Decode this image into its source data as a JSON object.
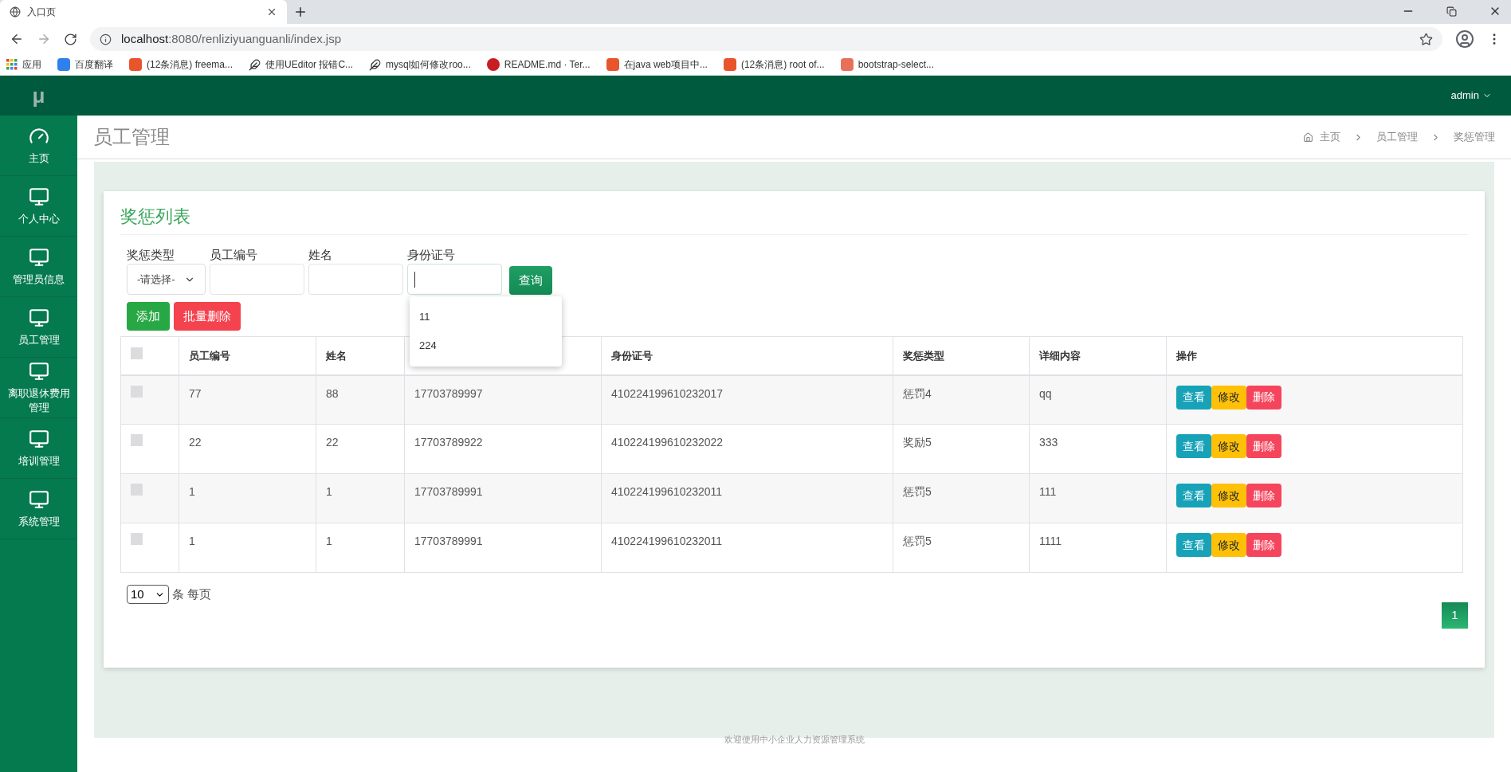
{
  "browser": {
    "tab_title": "入口页",
    "url_host": "localhost",
    "url_rest": ":8080/renliziyuanguanli/index.jsp",
    "bookmarks": [
      {
        "kind": "apps",
        "label": "应用"
      },
      {
        "kind": "translate",
        "label": "百度翻译"
      },
      {
        "kind": "csdn",
        "label": "(12条消息) freema..."
      },
      {
        "kind": "feather",
        "label": "使用UEditor 报错C..."
      },
      {
        "kind": "feather",
        "label": "mysql如何修改roo..."
      },
      {
        "kind": "gitee",
        "label": "README.md · Ter..."
      },
      {
        "kind": "csdn",
        "label": "在java web项目中..."
      },
      {
        "kind": "csdn",
        "label": "(12条消息) root of..."
      },
      {
        "kind": "jian",
        "label": "bootstrap-select..."
      }
    ]
  },
  "app": {
    "logo": "μ",
    "user": "admin"
  },
  "sidebar": {
    "items": [
      {
        "kind": "dashboard",
        "label": "主页"
      },
      {
        "kind": "monitor",
        "label": "个人中心"
      },
      {
        "kind": "monitor",
        "label": "管理员信息"
      },
      {
        "kind": "monitor",
        "label": "员工管理"
      },
      {
        "kind": "monitor",
        "label": "离职退休费用管理"
      },
      {
        "kind": "monitor",
        "label": "培训管理"
      },
      {
        "kind": "monitor",
        "label": "系统管理"
      }
    ]
  },
  "page_header": {
    "title": "员工管理",
    "breadcrumb": [
      "主页",
      "员工管理",
      "奖惩管理"
    ]
  },
  "card": {
    "title": "奖惩列表",
    "filters": [
      {
        "kind": "select",
        "label": "奖惩类型",
        "value": "-请选择-"
      },
      {
        "kind": "input",
        "label": "员工编号",
        "focused": false
      },
      {
        "kind": "input",
        "label": "姓名",
        "focused": false
      },
      {
        "kind": "input",
        "label": "身份证号",
        "focused": true
      }
    ],
    "autocomplete": [
      "11",
      "224"
    ],
    "query_button": "查询",
    "buttons": [
      {
        "kind": "add",
        "label": "添加"
      },
      {
        "kind": "delete",
        "label": "批量删除"
      }
    ],
    "table": {
      "select_all": {
        "checked": false
      },
      "columns": [
        {
          "label": "员工编号"
        },
        {
          "label": "姓名"
        },
        {},
        {
          "label": "身份证号"
        },
        {
          "label": "奖惩类型"
        },
        {
          "label": "详细内容"
        },
        {
          "label": "操作"
        }
      ],
      "rows": [
        {
          "checked": false,
          "cells": [
            "77",
            "88",
            "17703789997",
            "410224199610232017",
            "惩罚4",
            "qq"
          ],
          "actions": [
            "查看",
            "修改",
            "删除"
          ]
        },
        {
          "checked": false,
          "cells": [
            "22",
            "22",
            "17703789922",
            "410224199610232022",
            "奖励5",
            "333"
          ],
          "actions": [
            "查看",
            "修改",
            "删除"
          ]
        },
        {
          "checked": false,
          "cells": [
            "1",
            "1",
            "17703789991",
            "410224199610232011",
            "惩罚5",
            "111"
          ],
          "actions": [
            "查看",
            "修改",
            "删除"
          ]
        },
        {
          "checked": false,
          "cells": [
            "1",
            "1",
            "17703789991",
            "410224199610232011",
            "惩罚5",
            "1111"
          ],
          "actions": [
            "查看",
            "修改",
            "删除"
          ]
        }
      ]
    },
    "page_size": "10",
    "page_size_label": "条 每页",
    "pages": [
      {
        "label": "1",
        "selected": true
      }
    ]
  },
  "footer": "欢迎使用中小企业人力资源管理系统"
}
